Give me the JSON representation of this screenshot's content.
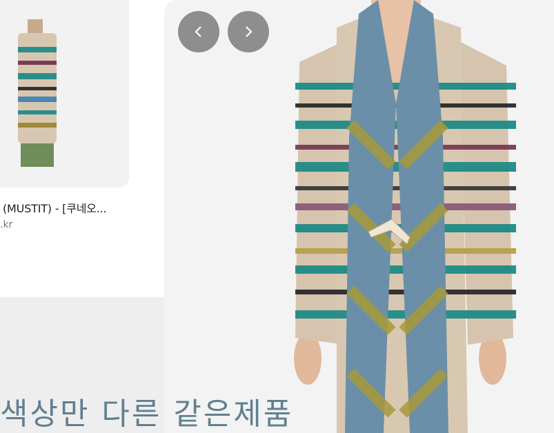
{
  "result": {
    "title": "(MUSTIT) - [쿠네오...",
    "domain": ".kr"
  },
  "nav": {
    "prev_icon": "chevron-left-icon",
    "next_icon": "chevron-right-icon"
  },
  "caption": "색상만 다른 같은제품",
  "colors": {
    "caption": "#5a7a8a",
    "nav_button": "#787878",
    "card_bg": "#f2f2f2"
  }
}
